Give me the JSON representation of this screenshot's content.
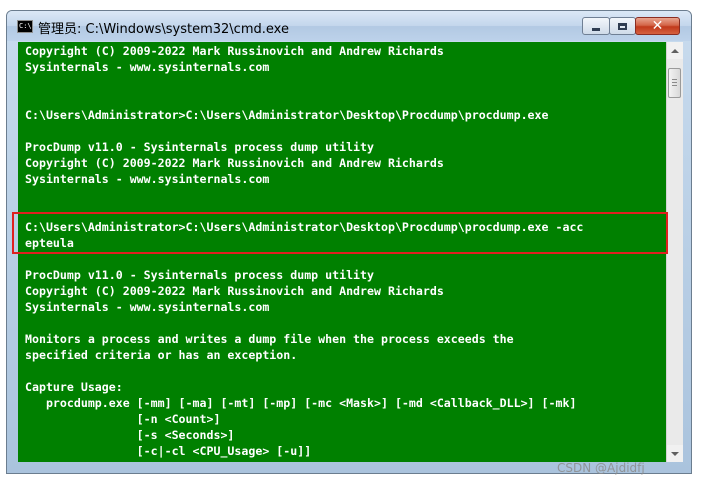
{
  "window": {
    "title": "管理员: C:\\Windows\\system32\\cmd.exe",
    "icon": "cmd-console-icon",
    "icon_text": "C:\\",
    "controls": {
      "minimize": "minimize-icon",
      "maximize": "maximize-icon",
      "close": "close-icon",
      "close_glyph": "✕"
    }
  },
  "colors": {
    "console_background": "#008000",
    "console_text": "#ffffff",
    "highlight_border": "#e02020"
  },
  "console": {
    "lines": [
      "Copyright (C) 2009-2022 Mark Russinovich and Andrew Richards",
      "Sysinternals - www.sysinternals.com",
      "",
      "",
      "C:\\Users\\Administrator>C:\\Users\\Administrator\\Desktop\\Procdump\\procdump.exe",
      "",
      "ProcDump v11.0 - Sysinternals process dump utility",
      "Copyright (C) 2009-2022 Mark Russinovich and Andrew Richards",
      "Sysinternals - www.sysinternals.com",
      "",
      "",
      "C:\\Users\\Administrator>C:\\Users\\Administrator\\Desktop\\Procdump\\procdump.exe -acc",
      "epteula",
      "",
      "ProcDump v11.0 - Sysinternals process dump utility",
      "Copyright (C) 2009-2022 Mark Russinovich and Andrew Richards",
      "Sysinternals - www.sysinternals.com",
      "",
      "Monitors a process and writes a dump file when the process exceeds the",
      "specified criteria or has an exception.",
      "",
      "Capture Usage:",
      "   procdump.exe [-mm] [-ma] [-mt] [-mp] [-mc <Mask>] [-md <Callback_DLL>] [-mk]",
      "                [-n <Count>]",
      "                [-s <Seconds>]",
      "                [-c|-cl <CPU_Usage> [-u]]"
    ]
  },
  "watermark": "CSDN @Ajdidfj"
}
